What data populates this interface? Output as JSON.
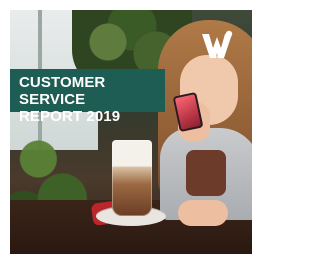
{
  "banner": {
    "line1": "CUSTOMER SERVICE",
    "line2": "REPORT 2019"
  },
  "logo": {
    "icon": "w-logo-icon"
  },
  "colors": {
    "banner_bg": "#1e5d53",
    "banner_text": "#ffffff"
  }
}
